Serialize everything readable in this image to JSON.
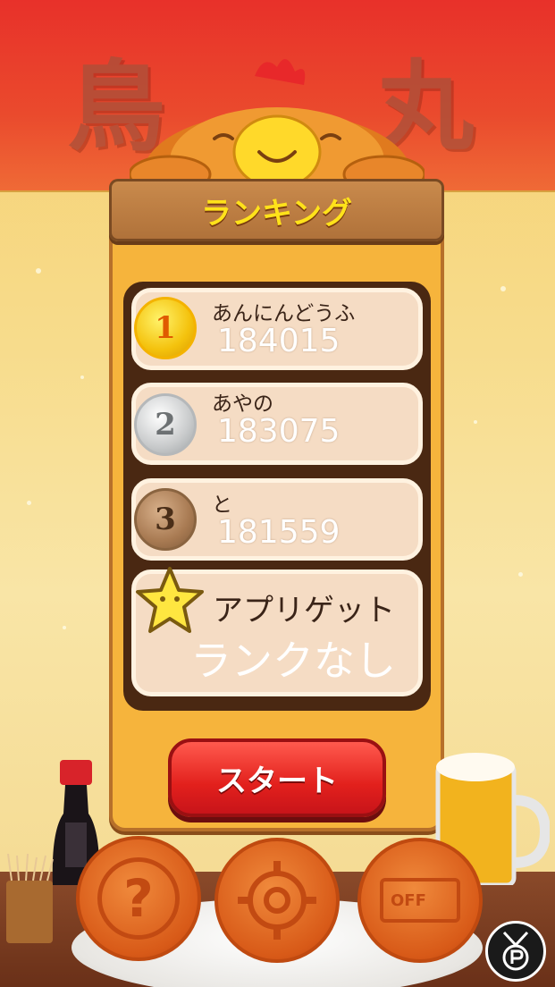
{
  "header": {
    "kanji_left": "鳥",
    "kanji_right": "丸"
  },
  "ranking": {
    "title": "ランキング",
    "entries": [
      {
        "rank": "1",
        "name": "あんにんどうふ",
        "score": "184015",
        "medal": "gold"
      },
      {
        "rank": "2",
        "name": "あやの",
        "score": "183075",
        "medal": "silver"
      },
      {
        "rank": "3",
        "name": "と",
        "score": "181559",
        "medal": "bronze"
      }
    ],
    "appliget": {
      "label": "アプリゲット",
      "status": "ランクなし"
    }
  },
  "start_button": {
    "label": "スタート"
  },
  "bottom_buttons": {
    "help_glyph": "?",
    "sound_label": "OFF"
  },
  "colors": {
    "banner_red": "#e8312a",
    "board_orange": "#f6b43c",
    "title_yellow": "#ffe21a",
    "start_red": "#e2201c",
    "cake_orange": "#d85a18"
  },
  "icons": [
    "chicken-mascot",
    "gold-medal",
    "silver-medal",
    "bronze-medal",
    "star-icon",
    "help-icon",
    "gear-icon",
    "sound-off-icon",
    "achievement-medal-icon"
  ]
}
